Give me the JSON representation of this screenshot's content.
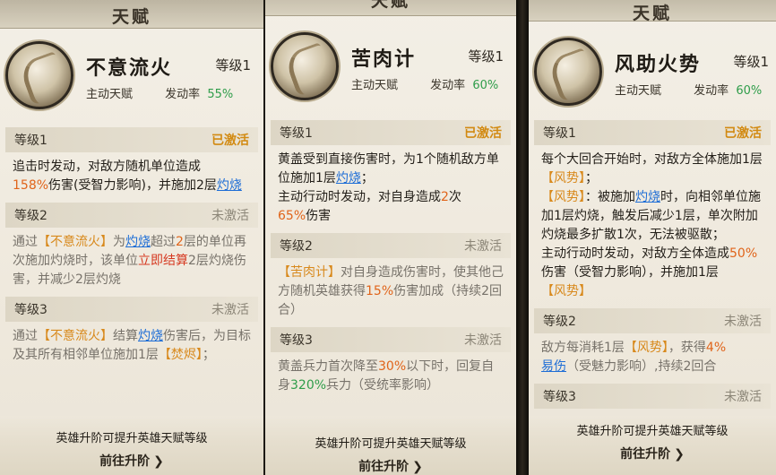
{
  "panels": [
    {
      "title": "天赋",
      "skill_name": "不意流火",
      "level": "等级1",
      "type": "主动天赋",
      "rate_label": "发动率",
      "rate": "55%",
      "levels": [
        {
          "label": "等级1",
          "status": "已激活",
          "t": [
            "追击时发动，对敌方随机单位造成",
            "158%",
            "伤害(受智力影响)，并施加2层",
            "灼烧"
          ]
        },
        {
          "label": "等级2",
          "status": "未激活",
          "t": [
            "通过",
            "【不意流火】",
            "为",
            "灼烧",
            "超过",
            "2",
            "层的单位再次施加灼烧时，该单位",
            "立即结算",
            "2层灼烧伤害，并减少2层灼烧"
          ]
        },
        {
          "label": "等级3",
          "status": "未激活",
          "t": [
            "通过",
            "【不意流火】",
            "结算",
            "灼烧",
            "伤害后，为目标及其所有相邻单位施加1层",
            "【焚烬】",
            "；"
          ]
        }
      ],
      "hint": "英雄升阶可提升英雄天赋等级",
      "go": "前往升阶"
    },
    {
      "title": "天赋",
      "skill_name": "苦肉计",
      "level": "等级1",
      "type": "主动天赋",
      "rate_label": "发动率",
      "rate": "60%",
      "levels": [
        {
          "label": "等级1",
          "status": "已激活",
          "t": [
            "黄盖受到直接伤害时，为1个随机敌方单位施加1层",
            "灼烧",
            "；",
            "主动行动时发动，对自身造成",
            "2",
            "次",
            "65%",
            "伤害"
          ]
        },
        {
          "label": "等级2",
          "status": "未激活",
          "t": [
            "【苦肉计】",
            "对自身造成伤害时，使其他己方随机英雄获得",
            "15%",
            "伤害加成（持续2回合）"
          ]
        },
        {
          "label": "等级3",
          "status": "未激活",
          "t": [
            "黄盖兵力首次降至",
            "30%",
            "以下时，回复自身",
            "320%",
            "兵力（受统率影响）"
          ]
        }
      ],
      "hint": "英雄升阶可提升英雄天赋等级",
      "go": "前往升阶"
    },
    {
      "title": "天赋",
      "skill_name": "风助火势",
      "level": "等级1",
      "type": "主动天赋",
      "rate_label": "发动率",
      "rate": "60%",
      "levels": [
        {
          "label": "等级1",
          "status": "已激活",
          "t": [
            "每个大回合开始时，对敌方全体施加1层",
            "【风势】",
            "；",
            "【风势】",
            "：被施加",
            "灼烧",
            "时，向相邻单位施加1层灼烧，触发后减少1层，单次附加灼烧最多扩散1次，无法被驱散；",
            "主动行动时发动，对敌方全体造成",
            "50%",
            "伤害（受智力影响），并施加1层",
            "【风势】"
          ]
        },
        {
          "label": "等级2",
          "status": "未激活",
          "t": [
            "敌方每消耗1层",
            "【风势】",
            "，获得",
            "4%",
            "易伤",
            "（受魅力影响）,持续2回合"
          ]
        },
        {
          "label": "等级3",
          "status": "未激活"
        }
      ],
      "hint": "英雄升阶可提升英雄天赋等级",
      "go": "前往升阶"
    }
  ]
}
